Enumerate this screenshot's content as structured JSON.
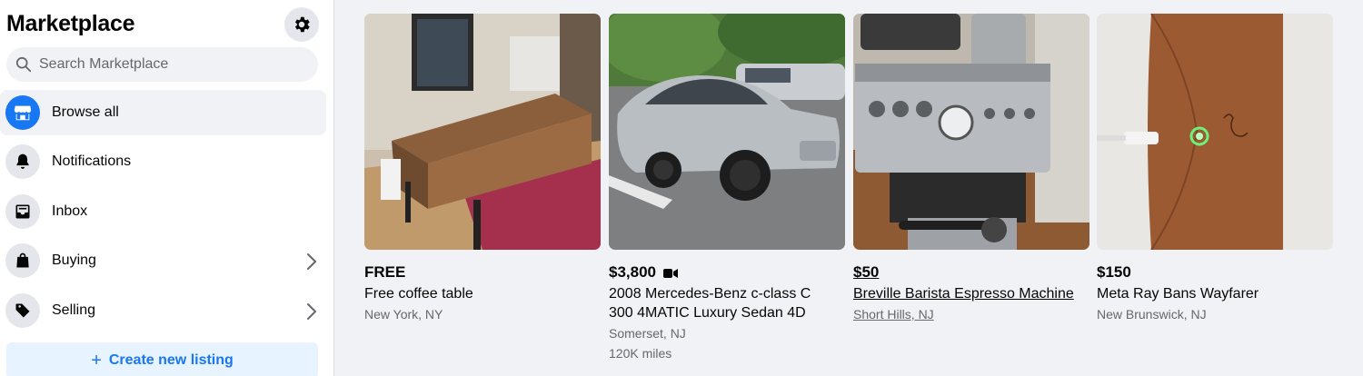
{
  "sidebar": {
    "title": "Marketplace",
    "search_placeholder": "Search Marketplace",
    "items": [
      {
        "label": "Browse all",
        "icon": "storefront-icon",
        "active": true
      },
      {
        "label": "Notifications",
        "icon": "bell-icon"
      },
      {
        "label": "Inbox",
        "icon": "inbox-icon"
      },
      {
        "label": "Buying",
        "icon": "shopping-bag-icon",
        "has_chevron": true
      },
      {
        "label": "Selling",
        "icon": "price-tag-icon",
        "has_chevron": true
      }
    ],
    "create_label": "Create new listing"
  },
  "colors": {
    "accent": "#1877f2",
    "background": "#f0f2f5",
    "muted_text": "#65676b"
  },
  "listings": [
    {
      "price": "FREE",
      "title": "Free coffee table",
      "location": "New York, NY"
    },
    {
      "price": "$3,800",
      "title_line1": "2008 Mercedes-Benz c-class C",
      "title_line2": "300 4MATIC Luxury Sedan 4D",
      "location": "Somerset, NJ",
      "mileage": "120K miles",
      "has_video": true
    },
    {
      "price": "$50",
      "title": "Breville Barista Espresso Machine",
      "location": "Short Hills, NJ"
    },
    {
      "price": "$150",
      "title": "Meta Ray Bans Wayfarer",
      "location": "New Brunswick, NJ"
    }
  ]
}
